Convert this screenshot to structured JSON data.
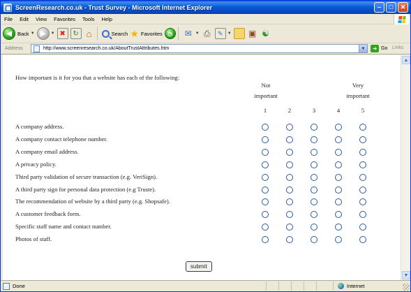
{
  "window": {
    "title": "ScreenResearch.co.uk - Trust Survey - Microsoft Internet Explorer"
  },
  "menubar": {
    "items": [
      "File",
      "Edit",
      "View",
      "Favorites",
      "Tools",
      "Help"
    ]
  },
  "toolbar": {
    "back_label": "Back",
    "search_label": "Search",
    "favorites_label": "Favorites"
  },
  "addressbar": {
    "label": "Address",
    "url": "http://www.screenresearch.co.uk/AboutTrustAttributes.htm",
    "go_label": "Go",
    "links_label": "Links"
  },
  "survey": {
    "question": "How important is it for you that a website has each of the following:",
    "scale_low_label": "Not important",
    "scale_high_label": "Very important",
    "scale": [
      "1",
      "2",
      "3",
      "4",
      "5"
    ],
    "items": [
      "A company address.",
      "A company contact telephone number.",
      "A company email address.",
      "A privacy policy.",
      "Third party validation of secure transaction (e.g. VeriSign).",
      "A third party sign for personal data protection (e.g Truste).",
      "The recommendation of website by a third party (e.g. Shopsafe).",
      "A customer feedback form.",
      "Specific staff name and contact number.",
      "Photos of staff."
    ],
    "submit_label": "submit"
  },
  "statusbar": {
    "status_text": "Done",
    "zone_text": "Internet"
  }
}
